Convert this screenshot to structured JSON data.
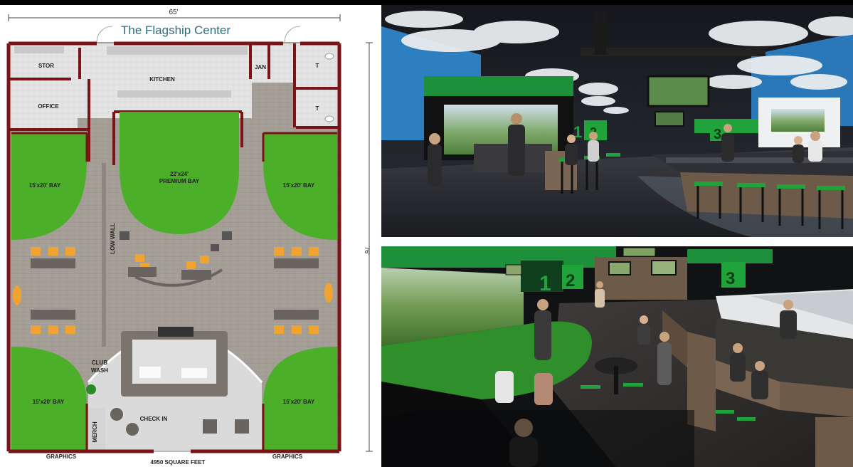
{
  "floor_plan": {
    "title": "The Flagship Center",
    "width_dimension": "65'",
    "height_dimension": "76'",
    "rooms": {
      "stor": "STOR",
      "kitchen": "KITCHEN",
      "jan": "JAN",
      "toilet_1": "T",
      "toilet_2": "T",
      "office": "OFFICE",
      "bay_top_left": "15'x20' BAY",
      "premium_bay_size": "22'x24'",
      "premium_bay_label": "PREMIUM BAY",
      "bay_top_right": "15'x20' BAY",
      "low_wall": "LOW WALL",
      "club": "CLUB",
      "wash": "WASH",
      "bay_bottom_left": "15'x20' BAY",
      "bay_bottom_right": "15'x20' BAY",
      "check_in": "CHECK IN",
      "merch": "MERCH"
    },
    "footer": {
      "graphics_left": "GRAPHICS",
      "square_feet": "4950 SQUARE FEET",
      "graphics_right": "GRAPHICS"
    }
  },
  "renders": {
    "top_bay_numbers": [
      "1",
      "2",
      "3"
    ],
    "bottom_bay_numbers": [
      "1",
      "2",
      "3"
    ]
  },
  "colors": {
    "wall": "#7a1416",
    "turf": "#4caf2a",
    "floor": "#a39e98",
    "accent_green": "#1fa33a"
  }
}
